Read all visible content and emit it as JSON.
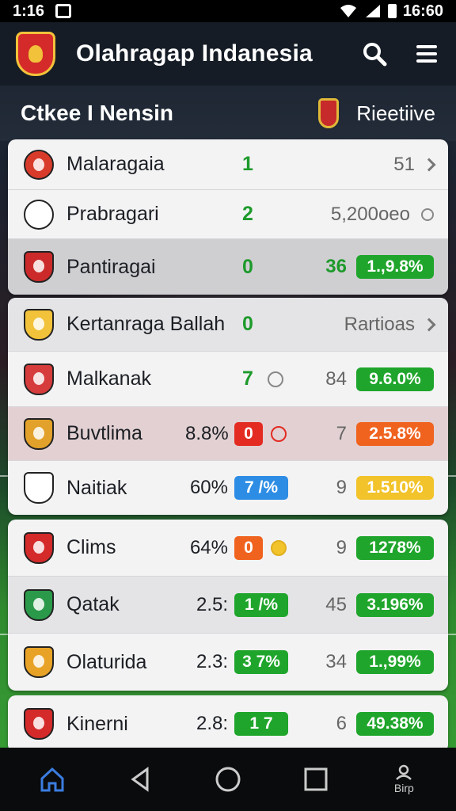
{
  "status_bar": {
    "time": "1:16",
    "right_text": "16:60"
  },
  "app_bar": {
    "title": "Olahragap Indanesia"
  },
  "section": {
    "title": "Ctkee I Nensin",
    "link": "Rieetiive"
  },
  "colors": {
    "green": "#1fa52b",
    "red": "#e32b22",
    "blue": "#2d8de4",
    "orange": "#f0631f",
    "yellow": "#f2c32a",
    "text_green": "#1e9a2b"
  },
  "rows": [
    {
      "name": "Malaragaia",
      "score": "1",
      "trailing": "51",
      "crest_color": "#d93b2b"
    },
    {
      "name": "Prabragari",
      "score": "2",
      "trailing": "5,200oeo",
      "crest_color": "#ffffff"
    },
    {
      "name": "Pantiragai",
      "score": "0",
      "number": "36",
      "badge": "1.,9.8%",
      "crest_color": "#cc2a2a"
    },
    {
      "name": "Kertanraga Ballah",
      "score": "0",
      "trailing": "Rartioas",
      "crest_color": "#f2c23a"
    },
    {
      "name": "Malkanak",
      "score": "7",
      "number": "84",
      "badge": "9.6.0%",
      "crest_color": "#d63c3c"
    },
    {
      "name": "Buvtlima",
      "pct": "8.8%",
      "pill": "0",
      "number": "7",
      "badge": "2.5.8%",
      "crest_color": "#e2a12a"
    },
    {
      "name": "Naitiak",
      "pct": "60%",
      "pill": "7 /%",
      "number": "9",
      "badge": "1.510%",
      "crest_color": "#ffffff"
    },
    {
      "name": "Clims",
      "pct": "64%",
      "pill": "0",
      "number": "9",
      "badge": "1278%",
      "crest_color": "#d42a2a"
    },
    {
      "name": "Qatak",
      "pct": "2.5:",
      "pill": "1 /%",
      "number": "45",
      "badge": "3.196%",
      "crest_color": "#2a9a4a"
    },
    {
      "name": "Olaturida",
      "pct": "2.3:",
      "pill": "3 7%",
      "number": "34",
      "badge": "1.,99%",
      "crest_color": "#e8a327"
    },
    {
      "name": "Kinerni",
      "pct": "2.8:",
      "pill": "1 7",
      "number": "6",
      "badge": "49.38%",
      "crest_color": "#d42a2a"
    }
  ],
  "nav": {
    "last_label": "Birp"
  }
}
